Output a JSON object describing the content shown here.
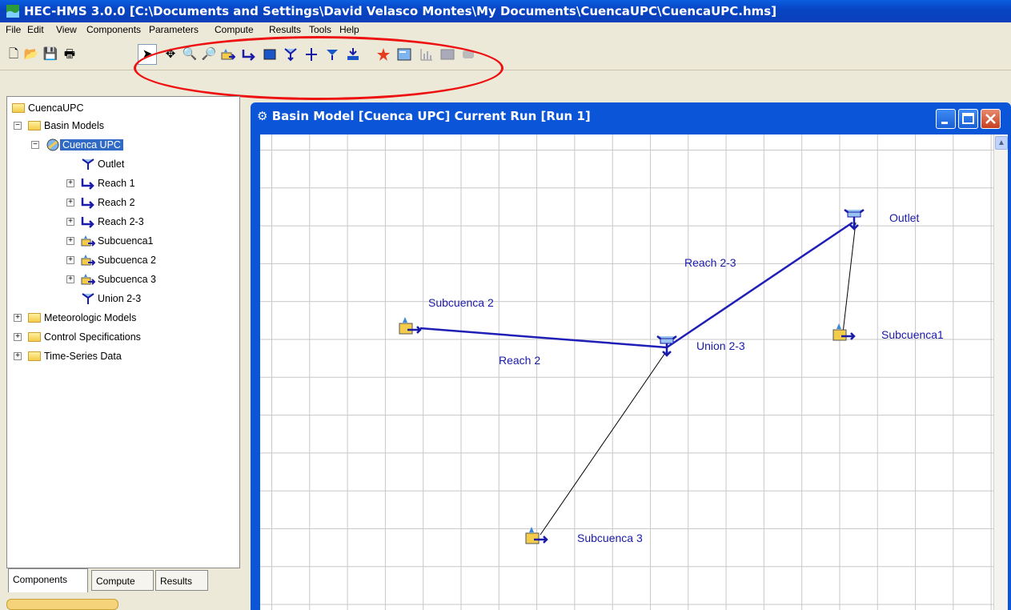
{
  "window": {
    "title": "HEC-HMS 3.0.0 [C:\\Documents and Settings\\David Velasco Montes\\My Documents\\CuencaUPC\\CuencaUPC.hms]"
  },
  "menu": [
    "File",
    "Edit",
    "View",
    "Components",
    "Parameters",
    "Compute",
    "Results",
    "Tools",
    "Help"
  ],
  "toolbar": {
    "buttons": [
      "new-file-icon",
      "open-folder-icon",
      "save-icon",
      "print-icon",
      "arrow-select-icon",
      "pan-icon",
      "zoom-in-icon",
      "zoom-out-icon",
      "subbasin-tool-icon",
      "reach-tool-icon",
      "reservoir-tool-icon",
      "junction-tool-icon",
      "diversion-tool-icon",
      "sink-tool-icon",
      "source-tool-icon",
      "compute-icon",
      "global-summary-icon",
      "graph-icon",
      "table-icon",
      "element-table-icon"
    ]
  },
  "tree": {
    "root": "CuencaUPC",
    "basin_models": "Basin Models",
    "basin": "Cuenca UPC",
    "elements": [
      "Outlet",
      "Reach 1",
      "Reach 2",
      "Reach 2-3",
      "Subcuenca1",
      "Subcuenca 2",
      "Subcuenca 3",
      "Union 2-3"
    ],
    "meteorologic": "Meteorologic Models",
    "control": "Control Specifications",
    "timeseries": "Time-Series Data"
  },
  "tabs": [
    "Components",
    "Compute",
    "Results"
  ],
  "basin_window": {
    "title": "Basin Model [Cuenca UPC]  Current Run [Run 1]"
  },
  "map_labels": {
    "outlet": "Outlet",
    "reach23": "Reach 2-3",
    "sub2": "Subcuenca 2",
    "sub1": "Subcuenca1",
    "union": "Union 2-3",
    "reach2": "Reach 2",
    "sub3": "Subcuenca 3"
  },
  "colors": {
    "title_bar": "#0a4fd0",
    "annotation_oval": "#e11111",
    "reach_line": "#1f1fb8",
    "label_text": "#1a1aa8"
  }
}
